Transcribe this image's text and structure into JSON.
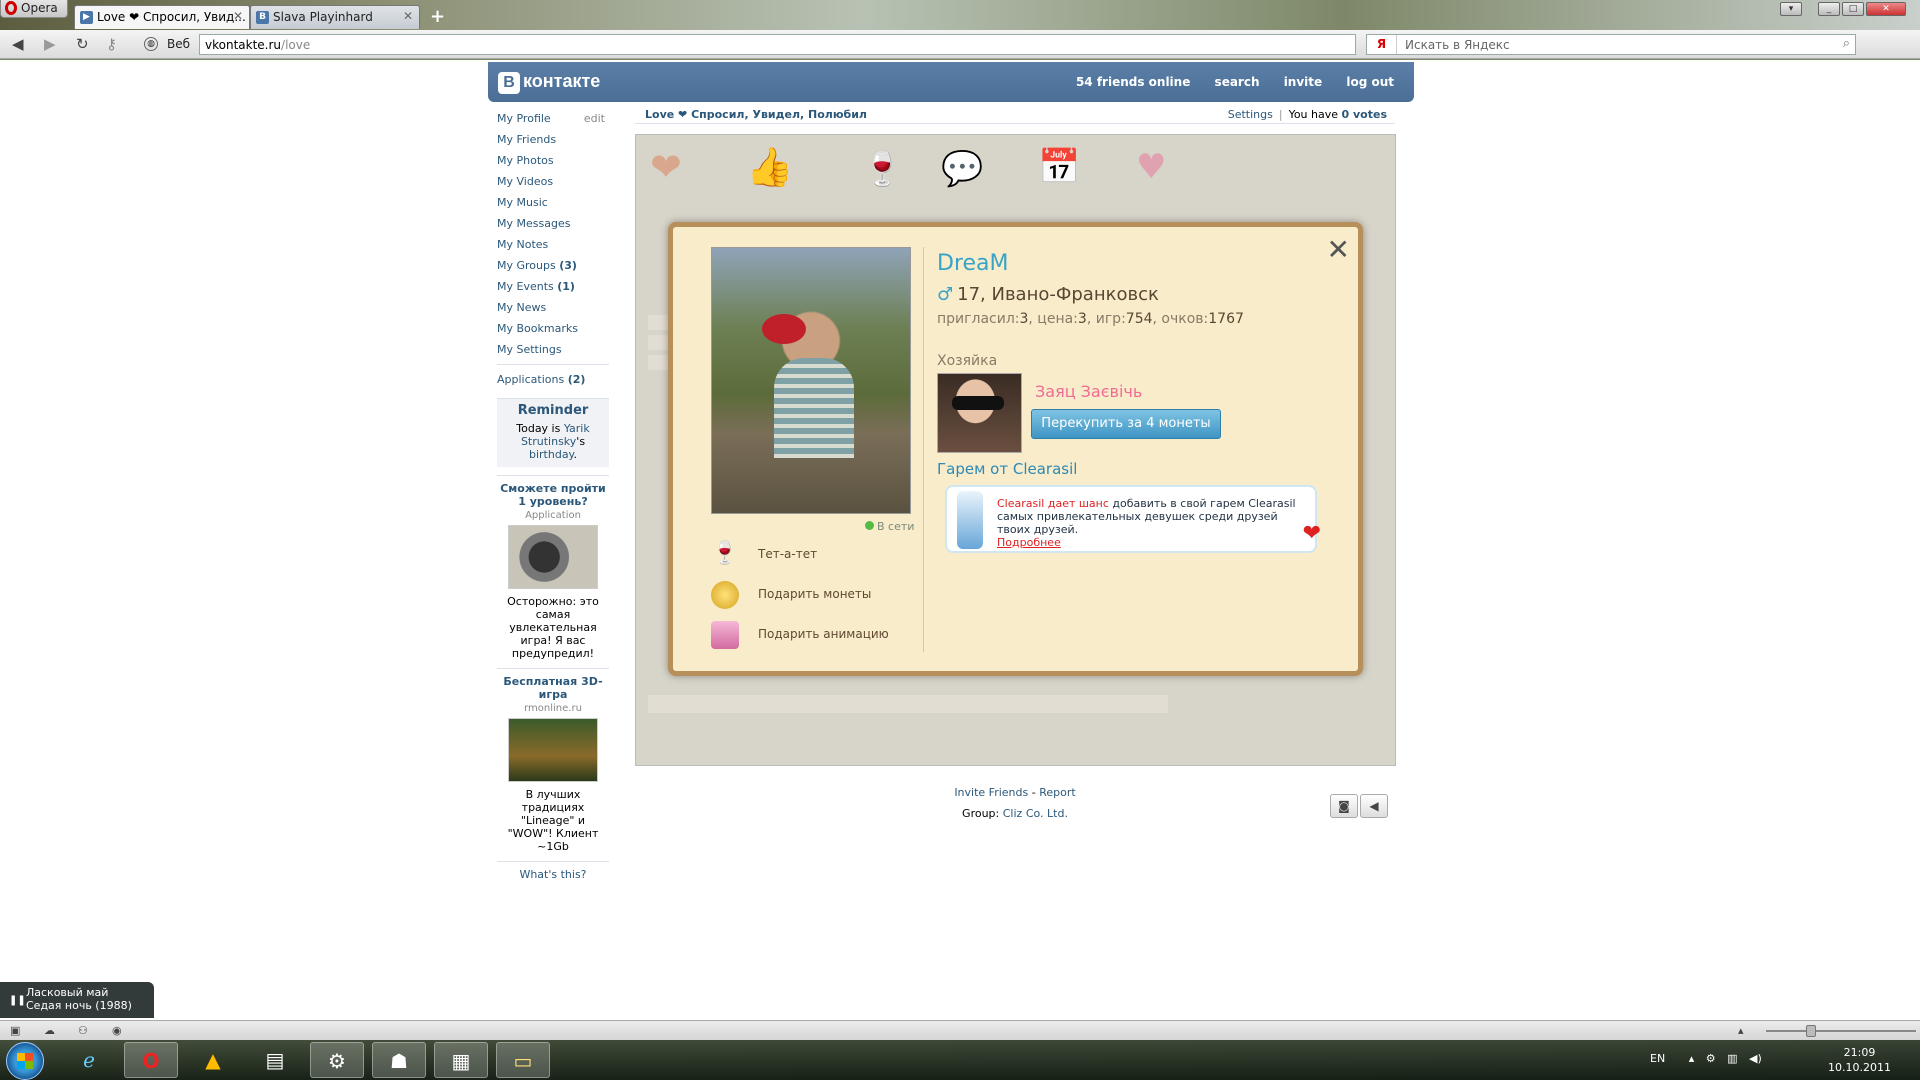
{
  "browser": {
    "menu_label": "Opera",
    "tabs": [
      {
        "title": "Love ❤ Спросил, Увид...",
        "active": true
      },
      {
        "title": "Slava Playinhard",
        "active": false
      }
    ],
    "new_tab": "+",
    "web_label": "Веб",
    "url_host": "vkontakte.ru",
    "url_path": "/love",
    "search_engine": "Я",
    "search_placeholder": "Искать в Яндекс"
  },
  "vk": {
    "logo_text": "контакте",
    "logo_letter": "В",
    "nav": {
      "friends_online": "54 friends online",
      "search": "search",
      "invite": "invite",
      "logout": "log out"
    },
    "menu": [
      {
        "label": "My Profile",
        "extra": "edit"
      },
      {
        "label": "My Friends"
      },
      {
        "label": "My Photos"
      },
      {
        "label": "My Videos"
      },
      {
        "label": "My Music"
      },
      {
        "label": "My Messages"
      },
      {
        "label": "My Notes"
      },
      {
        "label": "My Groups",
        "count": "(3)"
      },
      {
        "label": "My Events",
        "count": "(1)"
      },
      {
        "label": "My News"
      },
      {
        "label": "My Bookmarks"
      },
      {
        "label": "My Settings"
      }
    ],
    "applications": {
      "label": "Applications",
      "count": "(2)"
    },
    "reminder": {
      "title": "Reminder",
      "text_pre": "Today is ",
      "person": "Yarik Strutinsky",
      "text_post": "'s ",
      "link": "birthday",
      "end": "."
    },
    "ads": [
      {
        "title": "Сможете пройти 1 уровень?",
        "sub": "Application",
        "text": "Осторожно: это самая увлекательная игра! Я вас предупредил!"
      },
      {
        "title": "Бесплатная 3D-игра",
        "sub": "rmonline.ru",
        "text": "В лучших традициях \"Lineage\" и \"WOW\"! Клиент ~1Gb"
      }
    ],
    "whats_this": "What's this?",
    "app_title": "Love ❤ Спросил, Увидел, Полюбил",
    "settings": "Settings",
    "votes_pre": "You have ",
    "votes": "0 votes",
    "footer": {
      "invite_friends": "Invite Friends",
      "dash": "-",
      "report": "Report",
      "group_label": "Group:",
      "group_name": "Cliz Co. Ltd."
    }
  },
  "modal": {
    "close": "✕",
    "name": "DreaM",
    "gender_symbol": "♂",
    "age_city": "17, Ивано-Франковск",
    "stats_text": {
      "invited_label": "пригласил:",
      "invited": "3",
      "price_label": ", цена:",
      "price": "3",
      "games_label": ", игр:",
      "games": "754",
      "points_label": ", очков:",
      "points": "1767"
    },
    "online": "В сети",
    "actions": [
      {
        "label": "Тет-а-тет",
        "icon": "wine-glasses-icon"
      },
      {
        "label": "Подарить монеты",
        "icon": "coins-icon"
      },
      {
        "label": "Подарить анимацию",
        "icon": "gift-icon"
      }
    ],
    "owner_label": "Хозяйка",
    "owner_name": "Заяц Заєвічь",
    "buy_button": "Перекупить за 4 монеты",
    "harem_title": "Гарем от Clearasil",
    "banner": {
      "highlight": "Clearasil дает шанс",
      "text": " добавить в свой гарем Clearasil самых привлекательных девушек среди друзей твоих друзей.",
      "more": "Подробнее"
    }
  },
  "player": {
    "artist": "Ласковый май",
    "track": "Седая ночь (1988)"
  },
  "system": {
    "lang": "EN",
    "time": "21:09",
    "date": "10.10.2011"
  },
  "colors": {
    "vk_blue": "#4a6e96",
    "link": "#2b587a",
    "modal_bg": "#f8eccb",
    "modal_border": "#b78f5b",
    "accent_blue": "#37a3c7",
    "pink": "#ef6c93"
  }
}
